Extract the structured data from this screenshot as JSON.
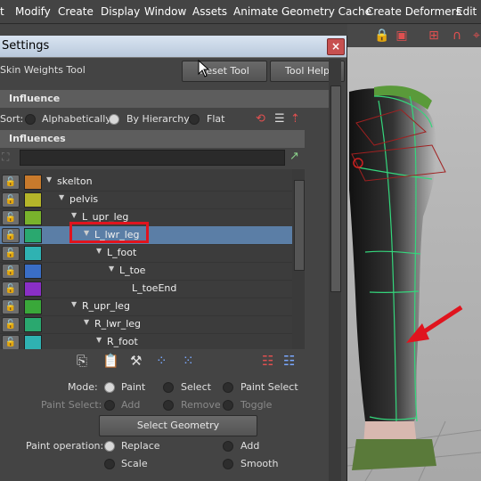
{
  "menubar": {
    "items": [
      "t",
      "Modify",
      "Create",
      "Display",
      "Window",
      "Assets",
      "Animate",
      "Geometry Cache",
      "Create Deformers",
      "Edit D"
    ]
  },
  "window": {
    "title": "Settings",
    "close_glyph": "×",
    "tool_name": "Skin Weights Tool",
    "reset_tool_label": "Reset Tool",
    "tool_help_label": "Tool Help"
  },
  "influence": {
    "header": "Influence",
    "sort_label": "Sort:",
    "sort_options": [
      "Alphabetically",
      "By Hierarchy",
      "Flat"
    ],
    "sort_selected": "By Hierarchy"
  },
  "influences": {
    "header": "Influences",
    "rows": [
      {
        "name": "skelton",
        "color": "#c87a2c",
        "selected": false
      },
      {
        "name": "pelvis",
        "color": "#b5b52a",
        "selected": false
      },
      {
        "name": "L_upr_leg",
        "color": "#79b22c",
        "selected": false
      },
      {
        "name": "L_lwr_leg",
        "color": "#2aa86f",
        "selected": true
      },
      {
        "name": "L_foot",
        "color": "#2fb2b2",
        "selected": false
      },
      {
        "name": "L_toe",
        "color": "#3a6ec6",
        "selected": false
      },
      {
        "name": "L_toeEnd",
        "color": "#8a2fc6",
        "selected": false
      },
      {
        "name": "R_upr_leg",
        "color": "#3aa83a",
        "selected": false
      },
      {
        "name": "R_lwr_leg",
        "color": "#2aa86f",
        "selected": false
      },
      {
        "name": "R_foot",
        "color": "#2fb2b2",
        "selected": false
      }
    ]
  },
  "mode": {
    "label": "Mode:",
    "options": [
      "Paint",
      "Select",
      "Paint Select"
    ],
    "selected": "Paint"
  },
  "paint_select": {
    "label": "Paint Select:",
    "options": [
      "Add",
      "Remove",
      "Toggle"
    ]
  },
  "select_geometry_label": "Select Geometry",
  "paint_operation": {
    "label": "Paint operation:",
    "options": [
      "Replace",
      "Add",
      "Scale",
      "Smooth"
    ],
    "selected": "Replace"
  },
  "colors": {
    "selection": "#5b7ea6",
    "highlight": "#e0141e",
    "mesh_wire": "#34d67c",
    "arrow": "#e0141e"
  }
}
